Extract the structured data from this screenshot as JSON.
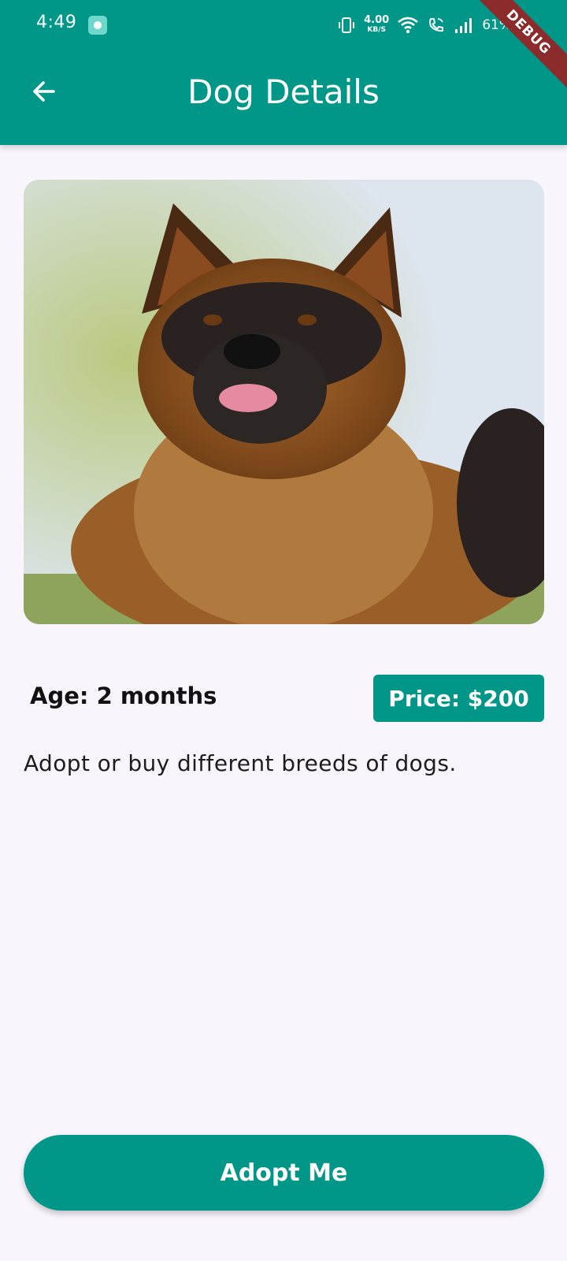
{
  "status_bar": {
    "time": "4:49",
    "net_speed_value": "4.00",
    "net_speed_unit": "KB/S",
    "battery": "61%",
    "icons": [
      "app-notification-icon",
      "vibrate-icon",
      "wifi-icon",
      "wifi-call-icon",
      "signal-icon"
    ]
  },
  "debug_banner": "DEBUG",
  "app_bar": {
    "title": "Dog Details",
    "back_icon": "arrow-back-icon"
  },
  "dog": {
    "image_alt": "German Shepherd",
    "age_text": "Age: 2 months",
    "price_text": "Price: $200",
    "description": "Adopt or buy different breeds of dogs."
  },
  "actions": {
    "adopt_label": "Adopt Me"
  },
  "colors": {
    "primary": "#009688",
    "background": "#f8f6fc",
    "debug_ribbon": "#8b2b2b"
  }
}
